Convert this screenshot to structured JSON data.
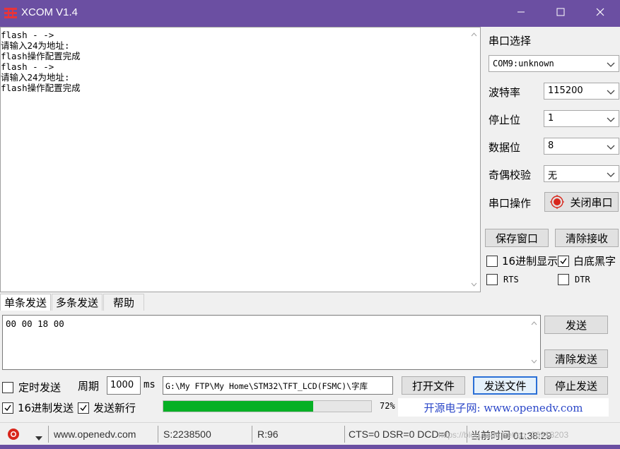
{
  "window": {
    "title": "XCOM V1.4",
    "icons": [
      "app-icon",
      "minimize-icon",
      "maximize-icon",
      "close-icon"
    ]
  },
  "receive": {
    "lines": [
      "flash - ->",
      "请输入24为地址:",
      "flash操作配置完成",
      "flash - ->",
      "请输入24为地址:",
      "flash操作配置完成"
    ]
  },
  "serial": {
    "section_title": "串口选择",
    "port": "COM9:unknown",
    "baud_label": "波特率",
    "baud": "115200",
    "stop_label": "停止位",
    "stop": "1",
    "data_label": "数据位",
    "data": "8",
    "parity_label": "奇偶校验",
    "parity": "无",
    "op_label": "串口操作",
    "op_button": "关闭串口",
    "save_window": "保存窗口",
    "clear_receive": "清除接收",
    "hex_display": "16进制显示",
    "hex_display_checked": false,
    "white_bg": "白底黑字",
    "white_bg_checked": true,
    "rts": "RTS",
    "rts_checked": false,
    "dtr": "DTR",
    "dtr_checked": false
  },
  "tabs": [
    "单条发送",
    "多条发送",
    "帮助"
  ],
  "send": {
    "text": "00 00 18 00",
    "send_button": "发送",
    "clear_send": "清除发送",
    "timed_send": "定时发送",
    "timed_send_checked": false,
    "period_label": "周期",
    "period_value": "1000",
    "period_unit": "ms",
    "file_path": "G:\\My  FTP\\My Home\\STM32\\TFT_LCD(FSMC)\\字库",
    "open_file": "打开文件",
    "send_file": "发送文件",
    "stop_send": "停止发送",
    "hex_send": "16进制发送",
    "hex_send_checked": true,
    "newline": "发送新行",
    "newline_checked": true,
    "progress": 72,
    "progress_label": "72%",
    "banner": "开源电子网: www.openedv.com"
  },
  "status": {
    "url": "www.openedv.com",
    "sent": "S:2238500",
    "received": "R:96",
    "lines": "CTS=0 DSR=0 DCD=0",
    "time": "当前时间 01:38:29",
    "watermark": "https://blog.csdn.net/qq_26918203"
  },
  "colors": {
    "titlebar": "#6b4fa2",
    "progress": "#06b025",
    "banner_blue": "#2b47c8",
    "record_red": "#d8261b"
  }
}
